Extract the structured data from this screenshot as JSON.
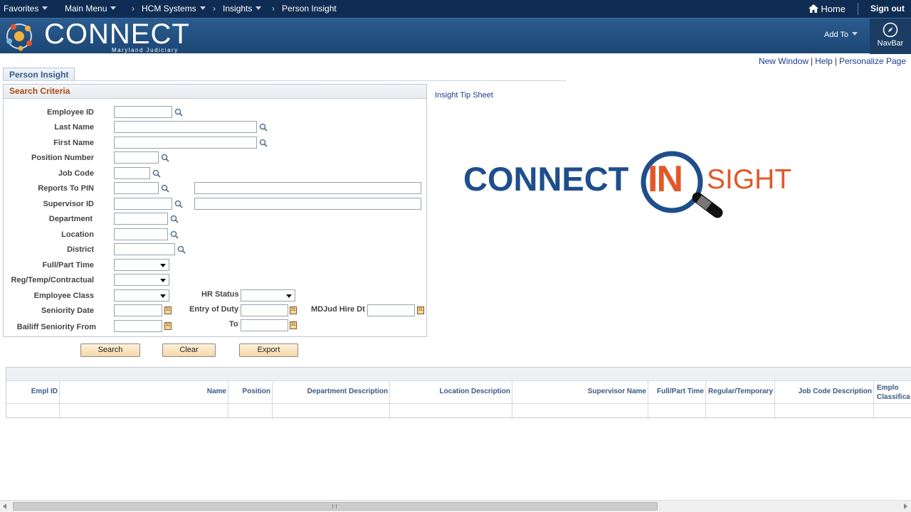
{
  "topnav": {
    "favorites": "Favorites",
    "main_menu": "Main Menu",
    "crumbs": [
      "HCM Systems",
      "Insights",
      "Person Insight"
    ],
    "home": "Home",
    "signout": "Sign out"
  },
  "banner": {
    "logo": "CONNECT",
    "logo_sub": "Maryland Judiciary",
    "add_to": "Add To",
    "navbar": "NavBar"
  },
  "links": {
    "new_window": "New Window",
    "help": "Help",
    "personalize": "Personalize Page"
  },
  "tab": {
    "label": "Person Insight"
  },
  "search": {
    "header": "Search Criteria",
    "labels": {
      "employee_id": "Employee ID",
      "last_name": "Last Name",
      "first_name": "First Name",
      "position_number": "Position Number",
      "job_code": "Job Code",
      "reports_to": "Reports To PIN",
      "supervisor_id": "Supervisor ID",
      "department": "Department",
      "location": "Location",
      "district": "District",
      "full_part": "Full/Part Time",
      "reg_temp": "Reg/Temp/Contractual",
      "employee_class": "Employee Class",
      "hr_status": "HR Status",
      "seniority_date": "Seniority Date",
      "entry_of_duty": "Entry of Duty",
      "hire_dt": "MDJud Hire Dt",
      "bailiff_from": "Bailiff Seniority From",
      "to": "To"
    },
    "buttons": {
      "search": "Search",
      "clear": "Clear",
      "export": "Export"
    }
  },
  "side": {
    "tip_sheet": "Insight Tip Sheet",
    "logo": {
      "connect": "CONNECT",
      "in": "IN",
      "sight": "SIGHT"
    }
  },
  "grid": {
    "columns": [
      "Empl ID",
      "Name",
      "Position",
      "Department Description",
      "Location Description",
      "Supervisor Name",
      "Full/Part Time",
      "Regular/Temporary",
      "Job Code Description",
      "Emplo Classifica"
    ]
  },
  "colors": {
    "topnav": "#0f2c52",
    "banner": "#1c4674",
    "accent_orange": "#e2582a",
    "link": "#1b3c8f",
    "header_text": "#a84a12"
  }
}
